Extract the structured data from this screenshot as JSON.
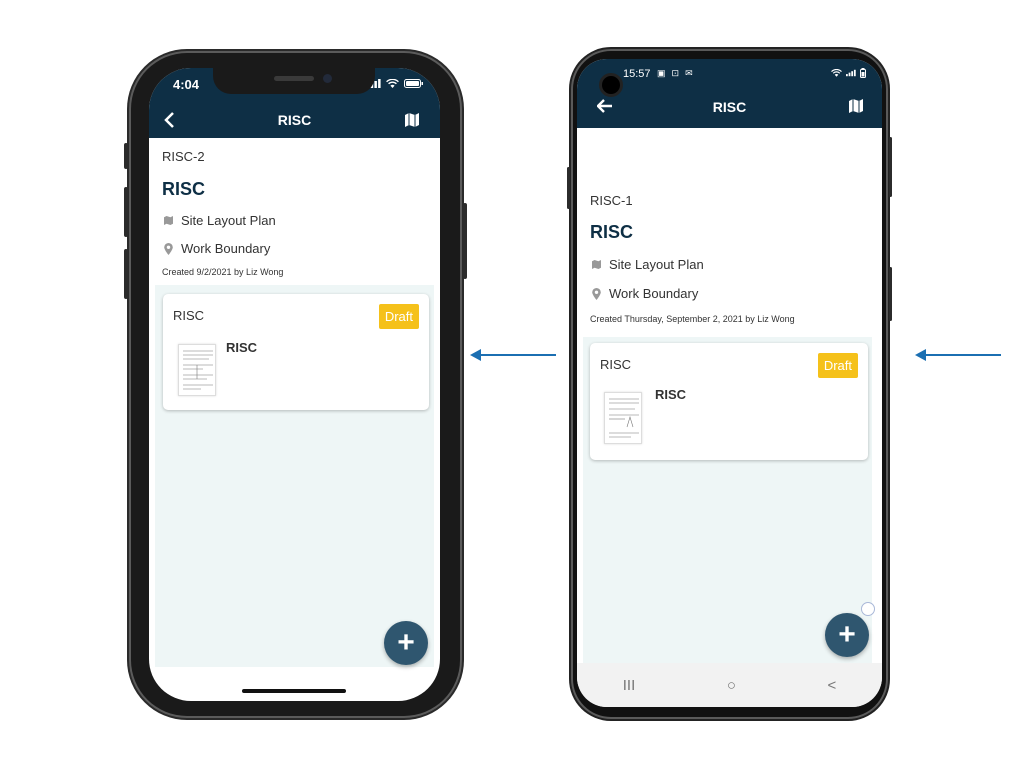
{
  "iphone": {
    "status_time": "4:04",
    "appbar_title": "RISC",
    "ref": "RISC-2",
    "title": "RISC",
    "map_label": "Site Layout Plan",
    "boundary_label": "Work Boundary",
    "created": "Created 9/2/2021 by Liz Wong",
    "card_label": "RISC",
    "status_badge": "Draft",
    "doc_name": "RISC",
    "fab_label": "+"
  },
  "android": {
    "status_time": "15:57",
    "appbar_title": "RISC",
    "ref": "RISC-1",
    "title": "RISC",
    "map_label": "Site Layout Plan",
    "boundary_label": "Work Boundary",
    "created": "Created Thursday, September 2, 2021 by Liz Wong",
    "card_label": "RISC",
    "status_badge": "Draft",
    "doc_name": "RISC",
    "fab_label": "+",
    "nav_recent": "III",
    "nav_home": "○",
    "nav_back": "<"
  },
  "colors": {
    "header": "#0e2f45",
    "badge": "#f5c11a",
    "fab": "#2f566f",
    "arrow": "#1b6fb2",
    "panel": "#eef6f6"
  },
  "icons": [
    "back-chevron-icon",
    "back-arrow-icon",
    "map-icon",
    "pin-icon",
    "add-icon",
    "signal-icon",
    "wifi-icon",
    "battery-icon"
  ]
}
